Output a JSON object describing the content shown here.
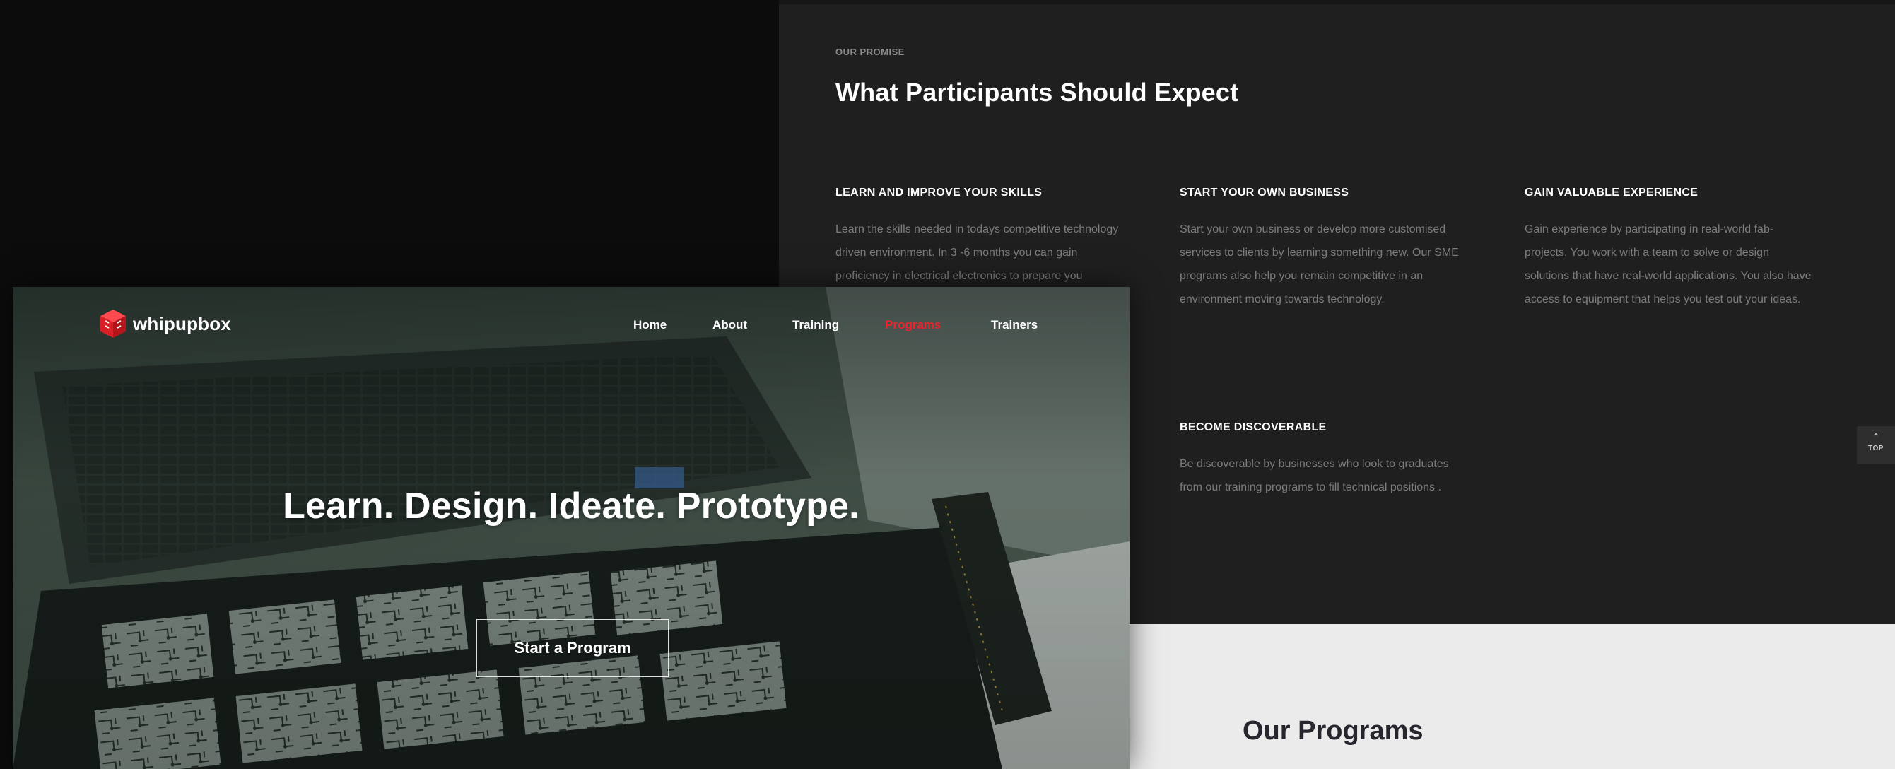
{
  "promise": {
    "eyebrow": "OUR PROMISE",
    "title": "What Participants Should Expect",
    "features": [
      {
        "title": "LEARN AND IMPROVE YOUR SKILLS",
        "text": "Learn the skills needed in todays competitive technology driven environment. In 3 -6 months you can gain proficiency in electrical electronics to prepare you"
      },
      {
        "title": "START YOUR OWN BUSINESS",
        "text": "Start your own business or develop more customised services to clients by learning something new. Our SME programs also help you remain competitive in an environment moving towards technology."
      },
      {
        "title": "GAIN VALUABLE EXPERIENCE",
        "text": "Gain experience by participating in real-world fab-projects. You work with a team to solve or design solutions that have real-world applications. You also have access to equipment that helps you test out your ideas."
      },
      {
        "title": "BECOME DISCOVERABLE",
        "text": "Be discoverable by businesses who look to graduates from our training programs to fill technical positions ."
      }
    ]
  },
  "top_button": {
    "label": "TOP",
    "icon": "chevron-up-icon"
  },
  "programs": {
    "title": "Our Programs"
  },
  "hero": {
    "brand": "whipupbox",
    "brand_color": "#e8262b",
    "nav": [
      {
        "label": "Home"
      },
      {
        "label": "About"
      },
      {
        "label": "Training"
      },
      {
        "label": "Programs",
        "active": true
      },
      {
        "label": "Trainers"
      }
    ],
    "headline": "Learn. Design. Ideate. Prototype.",
    "cta_label": "Start a Program"
  }
}
